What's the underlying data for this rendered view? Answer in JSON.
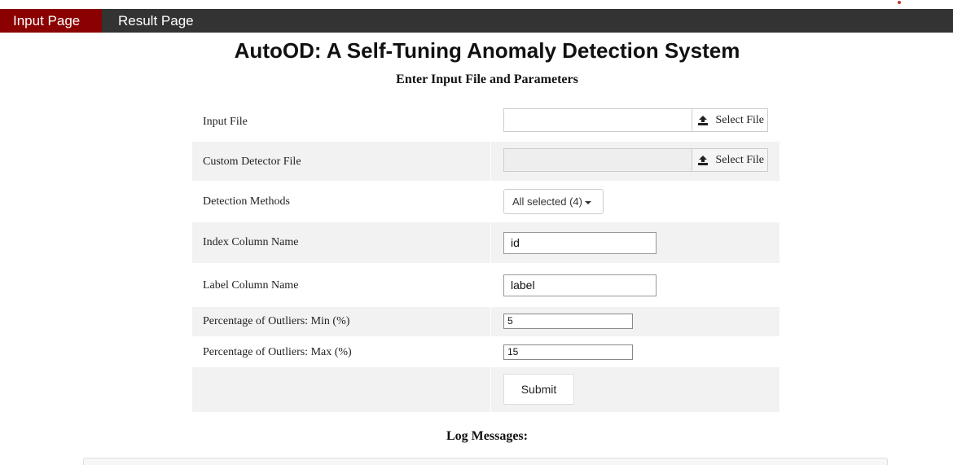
{
  "nav": {
    "tabs": [
      {
        "label": "Input Page",
        "active": true
      },
      {
        "label": "Result Page",
        "active": false
      }
    ]
  },
  "header": {
    "title": "AutoOD: A Self-Tuning Anomaly Detection System",
    "subtitle": "Enter Input File and Parameters"
  },
  "form": {
    "input_file": {
      "label": "Input File",
      "value": "",
      "button": "Select File"
    },
    "custom_detector_file": {
      "label": "Custom Detector File",
      "value": "",
      "button": "Select File",
      "disabled": true
    },
    "detection_methods": {
      "label": "Detection Methods",
      "selected": "All selected (4)"
    },
    "index_column": {
      "label": "Index Column Name",
      "value": "id"
    },
    "label_column": {
      "label": "Label Column Name",
      "value": "label"
    },
    "outliers_min": {
      "label": "Percentage of Outliers: Min (%)",
      "value": "5"
    },
    "outliers_max": {
      "label": "Percentage of Outliers: Max (%)",
      "value": "15"
    },
    "submit": "Submit"
  },
  "log": {
    "heading": "Log Messages:",
    "content": ""
  },
  "colors": {
    "navbar_bg": "#333333",
    "active_tab_bg": "#8b0000",
    "row_shade": "#f2f2f2"
  }
}
